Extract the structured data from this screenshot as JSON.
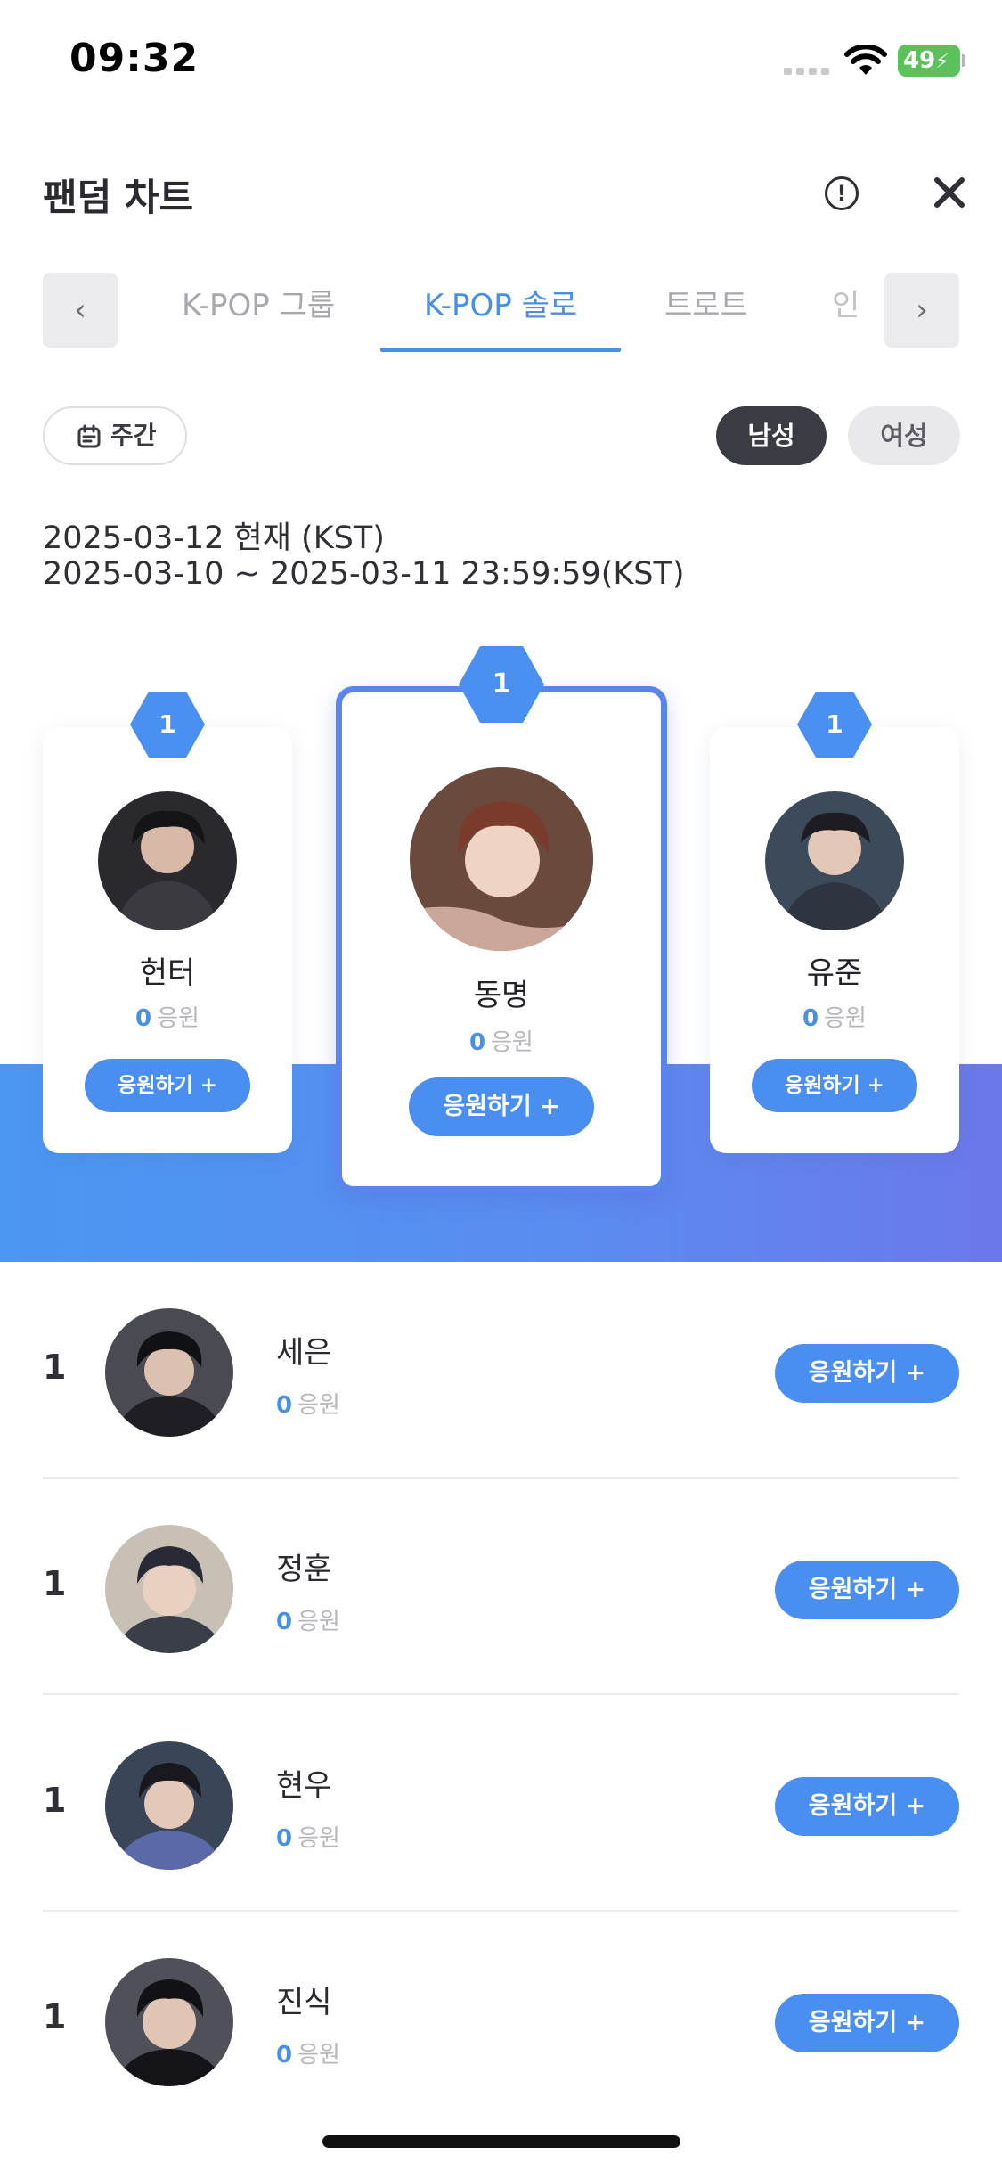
{
  "status_bar": {
    "time": "09:32",
    "battery": "49",
    "icons": [
      "signal-icon",
      "wifi-icon",
      "battery-charging-icon"
    ]
  },
  "header": {
    "title": "팬덤 차트",
    "info_label": "!",
    "icons": [
      "info-icon",
      "close-icon"
    ]
  },
  "tabs": {
    "prev": "‹",
    "next": "›",
    "items": [
      {
        "label": "K-POP 그룹",
        "active": false
      },
      {
        "label": "K-POP 솔로",
        "active": true
      },
      {
        "label": "트로트",
        "active": false
      },
      {
        "label": "인",
        "active": false
      }
    ]
  },
  "filters": {
    "period": "주간",
    "gender_male": "남성",
    "gender_female": "여성",
    "selected_gender": "남성"
  },
  "dates": {
    "current": "2025-03-12 현재 (KST)",
    "range": "2025-03-10 ~ 2025-03-11 23:59:59(KST)"
  },
  "podium": [
    {
      "position": "left",
      "rank": "1",
      "name": "헌터",
      "votes": "0",
      "votes_unit": "응원",
      "button": "응원하기 +"
    },
    {
      "position": "center",
      "rank": "1",
      "name": "동명",
      "votes": "0",
      "votes_unit": "응원",
      "button": "응원하기 +"
    },
    {
      "position": "right",
      "rank": "1",
      "name": "유준",
      "votes": "0",
      "votes_unit": "응원",
      "button": "응원하기 +"
    }
  ],
  "ranking": [
    {
      "rank": "1",
      "name": "세은",
      "votes": "0",
      "votes_unit": "응원",
      "button": "응원하기 +"
    },
    {
      "rank": "1",
      "name": "정훈",
      "votes": "0",
      "votes_unit": "응원",
      "button": "응원하기 +"
    },
    {
      "rank": "1",
      "name": "현우",
      "votes": "0",
      "votes_unit": "응원",
      "button": "응원하기 +"
    },
    {
      "rank": "1",
      "name": "진식",
      "votes": "0",
      "votes_unit": "응원",
      "button": "응원하기 +"
    }
  ],
  "colors": {
    "accent": "#4a90e2",
    "button": "#4a8ff0",
    "gradient_start": "#4b97f2",
    "gradient_end": "#6b78ea",
    "dark_chip": "#3b3c43"
  }
}
